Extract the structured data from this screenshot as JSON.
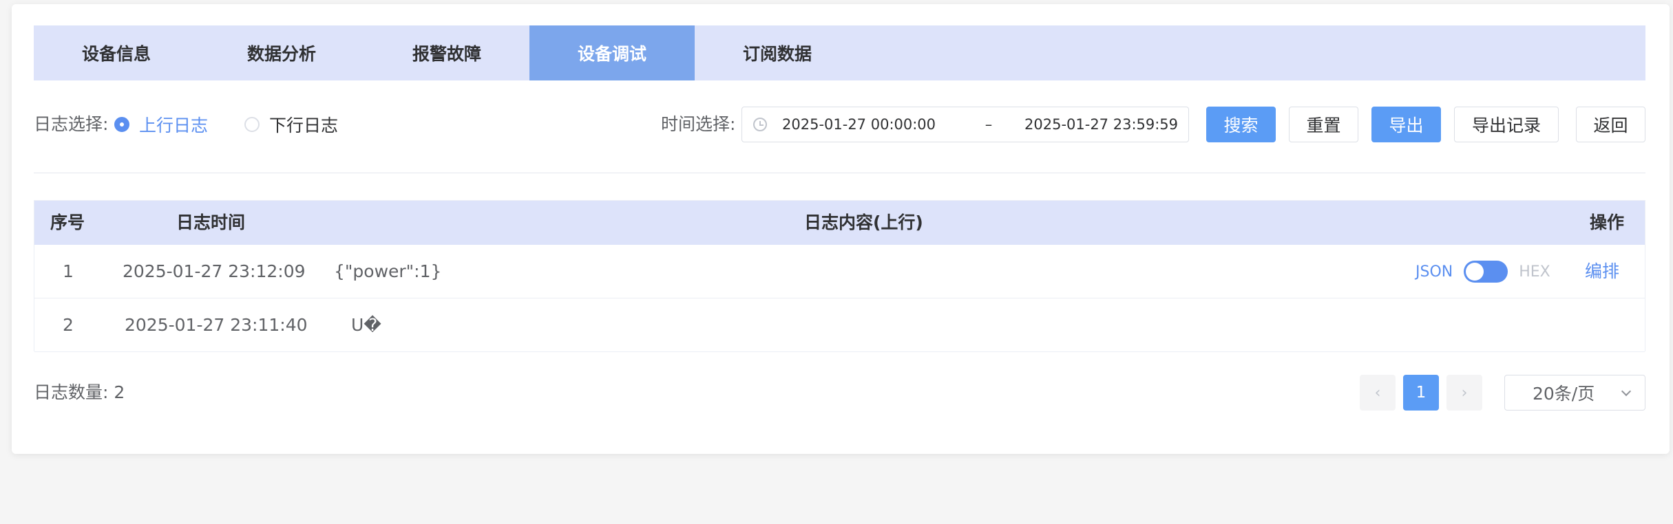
{
  "tabs": [
    "设备信息",
    "数据分析",
    "报警故障",
    "设备调试",
    "订阅数据"
  ],
  "active_tab": "设备调试",
  "filter": {
    "log_label": "日志选择:",
    "radio_up": "上行日志",
    "radio_down": "下行日志",
    "selected": "上行日志",
    "time_label": "时间选择:",
    "start": "2025-01-27 00:00:00",
    "separator": "–",
    "end": "2025-01-27 23:59:59"
  },
  "buttons": {
    "search": "搜索",
    "reset": "重置",
    "export": "导出",
    "export_records": "导出记录",
    "back": "返回"
  },
  "table": {
    "headers": {
      "index": "序号",
      "time": "日志时间",
      "content": "日志内容(上行)",
      "action": "操作"
    },
    "rows": [
      {
        "index": "1",
        "time": "2025-01-27 23:12:09",
        "content": "{\"power\":1}"
      },
      {
        "index": "2",
        "time": "2025-01-27 23:11:40",
        "content": "U�"
      }
    ],
    "toggle_left": "JSON",
    "toggle_right": "HEX",
    "toggle_state": "JSON",
    "action_link": "编排"
  },
  "footer": {
    "count_text": "日志数量: 2",
    "prev_icon": "‹",
    "page": "1",
    "next_icon": "›",
    "page_size": "20条/页"
  },
  "colors": {
    "accent": "#5b9cf5",
    "tab_bg": "#dde3fa",
    "tab_active": "#7ca6ec"
  }
}
